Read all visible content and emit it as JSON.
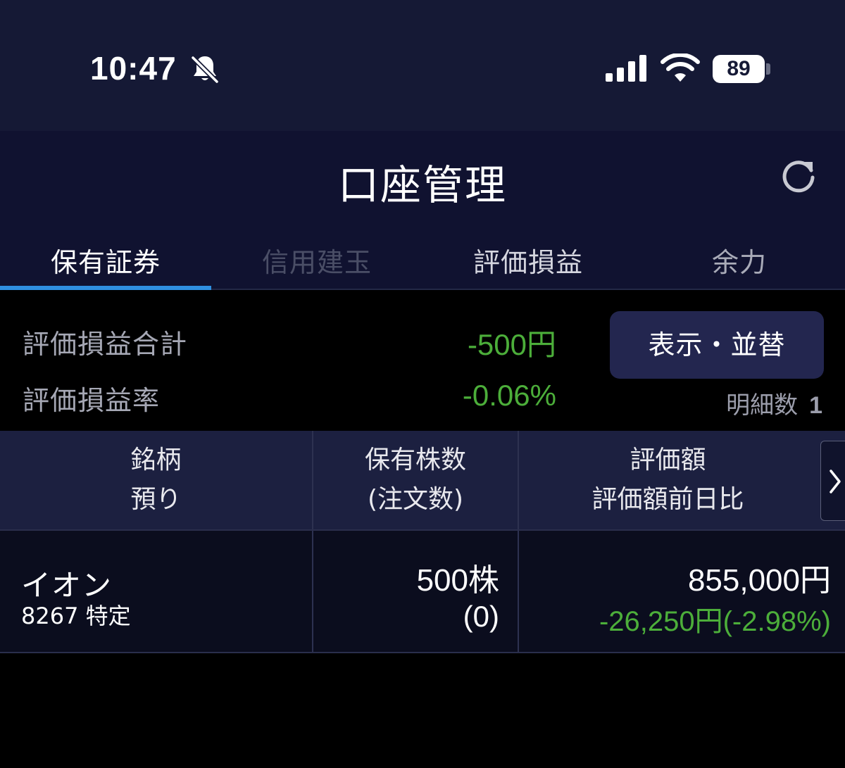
{
  "status_bar": {
    "time": "10:47",
    "battery": "89"
  },
  "header": {
    "title": "口座管理"
  },
  "tabs": [
    {
      "label": "保有証券",
      "state": "active"
    },
    {
      "label": "信用建玉",
      "state": "disabled"
    },
    {
      "label": "評価損益",
      "state": "normal"
    },
    {
      "label": "余力",
      "state": "normal"
    }
  ],
  "summary": {
    "total_pl_label": "評価損益合計",
    "total_pl_value": "-500円",
    "pl_rate_label": "評価損益率",
    "pl_rate_value": "-0.06%",
    "sort_button_label": "表示・並替",
    "detail_count_label": "明細数",
    "detail_count_value": "1"
  },
  "table": {
    "headers": [
      {
        "line1": "銘柄",
        "line2": "預り"
      },
      {
        "line1": "保有株数",
        "line2": "(注文数)"
      },
      {
        "line1": "評価額",
        "line2": "評価額前日比"
      }
    ],
    "rows": [
      {
        "name": "イオン",
        "code_account": "8267 特定",
        "quantity": "500株",
        "order_quantity": "(0)",
        "valuation": "855,000円",
        "valuation_change": "-26,250円(-2.98%)"
      }
    ]
  },
  "colors": {
    "status_bar_bg": "#151935",
    "header_bg": "#101230",
    "tab_indicator": "#2f8fe0",
    "negative_green": "#4cae3a",
    "button_bg": "#23264f",
    "table_header_bg": "#1c2040"
  },
  "icons": {
    "bell": "bell-slash-icon",
    "signal": "cellular-signal-icon",
    "wifi": "wifi-icon",
    "refresh": "refresh-icon",
    "next": "chevron-right-icon"
  }
}
